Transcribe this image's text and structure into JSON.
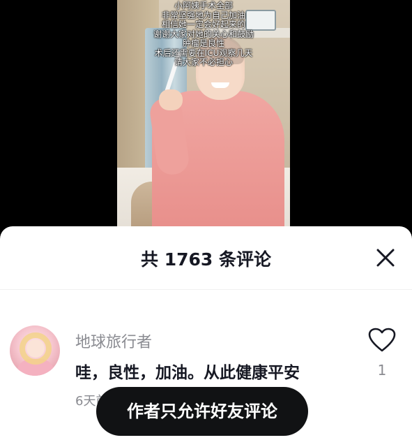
{
  "video": {
    "overlay_lines": [
      "小阿姨手术全部",
      "非常坚强地为自己加油",
      "相信她一定会好起来的",
      "谢谢大家对她的关心和鼓励",
      "肿瘤是良性",
      "术后还需要在ICU观察几天",
      "请大家不必担心"
    ]
  },
  "comments_panel": {
    "title": "共 1763 条评论",
    "close_icon": "close-icon"
  },
  "comments": [
    {
      "username": "地球旅行者",
      "text": "哇，良性，加油。从此健康平安",
      "meta": "6天前 · 回复",
      "like_count": "1",
      "avatar_icon": "avatar-anime-girl"
    }
  ],
  "toast": {
    "message": "作者只允许好友评论"
  },
  "colors": {
    "sheet_bg": "#ffffff",
    "title_text": "#161823",
    "secondary_text": "#8a8b91",
    "toast_bg": "#111214"
  }
}
